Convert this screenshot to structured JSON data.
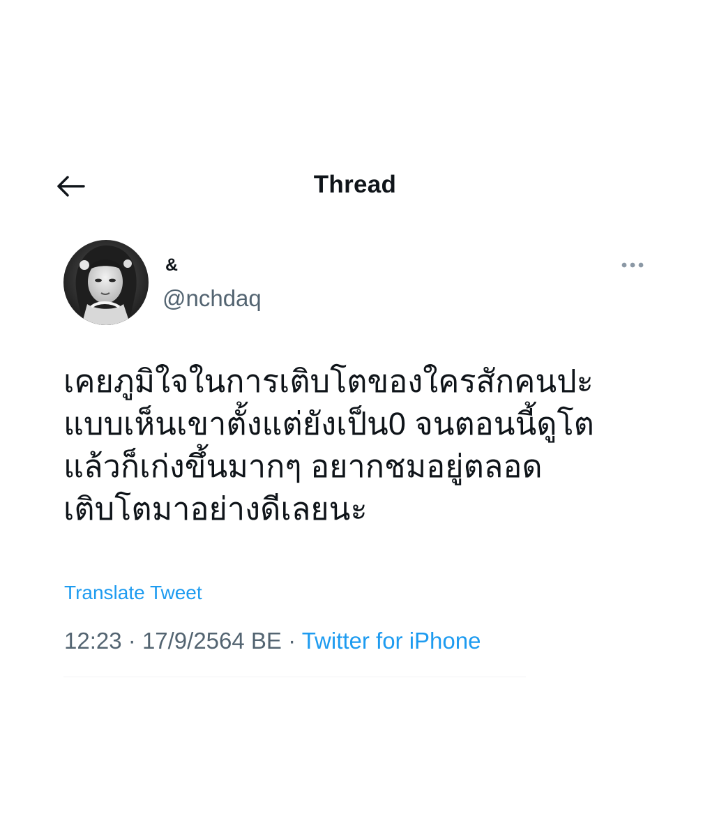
{
  "header": {
    "back_icon": "arrow-left-icon",
    "title": "Thread"
  },
  "tweet": {
    "display_name": "&",
    "handle": "@nchdaq",
    "more_icon": "more-horizontal-icon",
    "text_lines": [
      "เคยภูมิใจในการเติบโตของใครสักคนปะ",
      "แบบเห็นเขาตั้งแต่ยังเป็น0 จนตอนนี้ดูโต",
      "แล้วก็เก่งขึ้นมากๆ อยากชมอยู่ตลอด",
      "เติบโตมาอย่างดีเลยนะ"
    ],
    "translate_label": "Translate Tweet",
    "time": "12:23",
    "separator": "·",
    "date": "17/9/2564 BE",
    "source": "Twitter for iPhone"
  },
  "colors": {
    "accent": "#1d9bf0",
    "text_primary": "#0f1419",
    "text_secondary": "#536471"
  }
}
